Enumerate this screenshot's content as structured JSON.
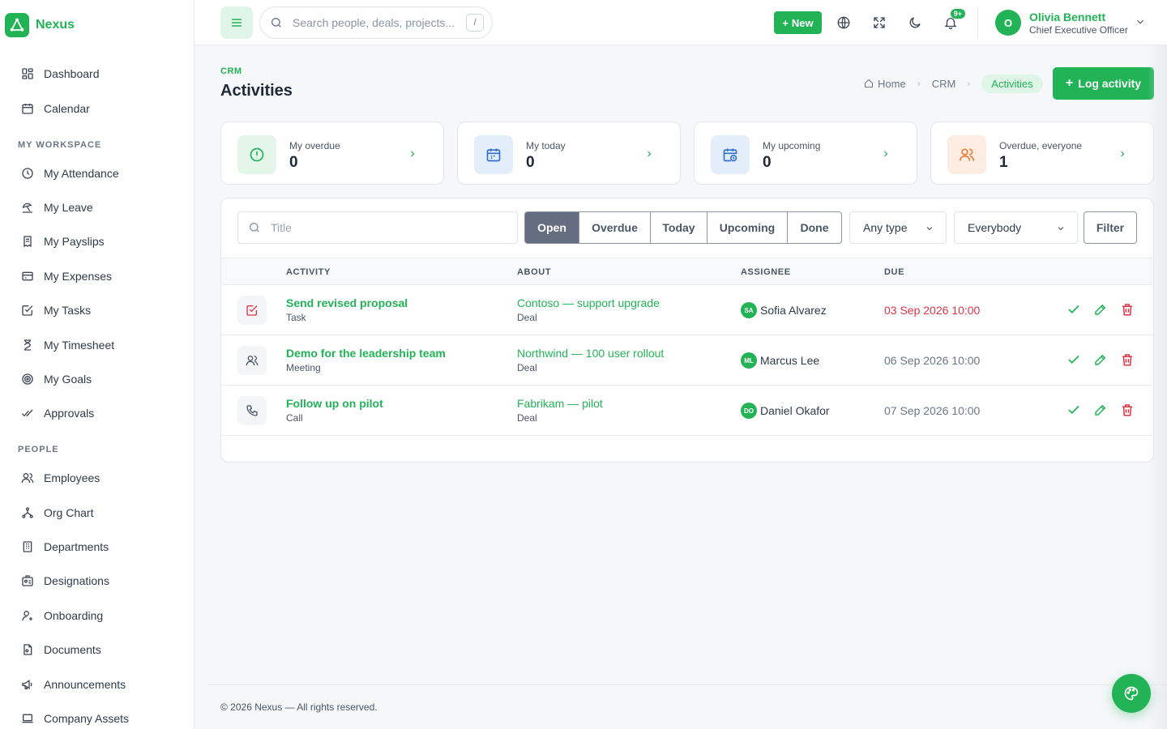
{
  "brand": {
    "name": "Nexus",
    "color": "#22b357"
  },
  "sidebar": {
    "top_items": [
      {
        "label": "Dashboard",
        "icon": "dashboard-icon"
      },
      {
        "label": "Calendar",
        "icon": "calendar-icon"
      }
    ],
    "sections": [
      {
        "title": "MY WORKSPACE",
        "items": [
          {
            "label": "My Attendance",
            "icon": "clock-icon"
          },
          {
            "label": "My Leave",
            "icon": "beach-icon"
          },
          {
            "label": "My Payslips",
            "icon": "receipt-icon"
          },
          {
            "label": "My Expenses",
            "icon": "wallet-icon"
          },
          {
            "label": "My Tasks",
            "icon": "checkbox-icon"
          },
          {
            "label": "My Timesheet",
            "icon": "hourglass-icon"
          },
          {
            "label": "My Goals",
            "icon": "target-icon"
          },
          {
            "label": "Approvals",
            "icon": "double-check-icon"
          }
        ]
      },
      {
        "title": "PEOPLE",
        "items": [
          {
            "label": "Employees",
            "icon": "users-icon"
          },
          {
            "label": "Org Chart",
            "icon": "org-chart-icon"
          },
          {
            "label": "Departments",
            "icon": "building-icon"
          },
          {
            "label": "Designations",
            "icon": "id-badge-icon"
          },
          {
            "label": "Onboarding",
            "icon": "user-plus-icon"
          },
          {
            "label": "Documents",
            "icon": "document-icon"
          },
          {
            "label": "Announcements",
            "icon": "megaphone-icon"
          },
          {
            "label": "Company Assets",
            "icon": "laptop-icon"
          }
        ]
      }
    ]
  },
  "topbar": {
    "search_placeholder": "Search people, deals, projects...",
    "search_shortcut": "/",
    "new_label": "New",
    "notification_badge": "9+",
    "user": {
      "initial": "O",
      "name": "Olivia Bennett",
      "role": "Chief Executive Officer"
    }
  },
  "page": {
    "section": "CRM",
    "title": "Activities",
    "breadcrumb": [
      "Home",
      "CRM",
      "Activities"
    ],
    "log_button": "Log activity"
  },
  "stats": [
    {
      "label": "My overdue",
      "value": "0",
      "icon": "alert-circle-icon",
      "bg": "#e3f6e9",
      "fg": "#22b357"
    },
    {
      "label": "My today",
      "value": "0",
      "icon": "calendar-icon",
      "bg": "#e4eefa",
      "fg": "#2f6fcf"
    },
    {
      "label": "My upcoming",
      "value": "0",
      "icon": "calendar-clock-icon",
      "bg": "#e4eefa",
      "fg": "#2f6fcf"
    },
    {
      "label": "Overdue, everyone",
      "value": "1",
      "icon": "users-icon",
      "bg": "#fdece2",
      "fg": "#f07b3a"
    }
  ],
  "filters": {
    "title_placeholder": "Title",
    "tabs": [
      "Open",
      "Overdue",
      "Today",
      "Upcoming",
      "Done"
    ],
    "active_tab": "Open",
    "type_select": "Any type",
    "owner_select": "Everybody",
    "filter_button": "Filter"
  },
  "table": {
    "columns": [
      "ACTIVITY",
      "ABOUT",
      "ASSIGNEE",
      "DUE"
    ],
    "rows": [
      {
        "icon": "task-check-icon",
        "title": "Send revised proposal",
        "type": "Task",
        "about": "Contoso — support upgrade",
        "about_type": "Deal",
        "assignee_initials": "SA",
        "assignee": "Sofia Alvarez",
        "due": "03 Sep 2026 10:00",
        "overdue": true
      },
      {
        "icon": "users-icon",
        "title": "Demo for the leadership team",
        "type": "Meeting",
        "about": "Northwind — 100 user rollout",
        "about_type": "Deal",
        "assignee_initials": "ML",
        "assignee": "Marcus Lee",
        "due": "06 Sep 2026 10:00",
        "overdue": false
      },
      {
        "icon": "phone-icon",
        "title": "Follow up on pilot",
        "type": "Call",
        "about": "Fabrikam — pilot",
        "about_type": "Deal",
        "assignee_initials": "DO",
        "assignee": "Daniel Okafor",
        "due": "07 Sep 2026 10:00",
        "overdue": false
      }
    ]
  },
  "footer": "© 2026 Nexus — All rights reserved."
}
